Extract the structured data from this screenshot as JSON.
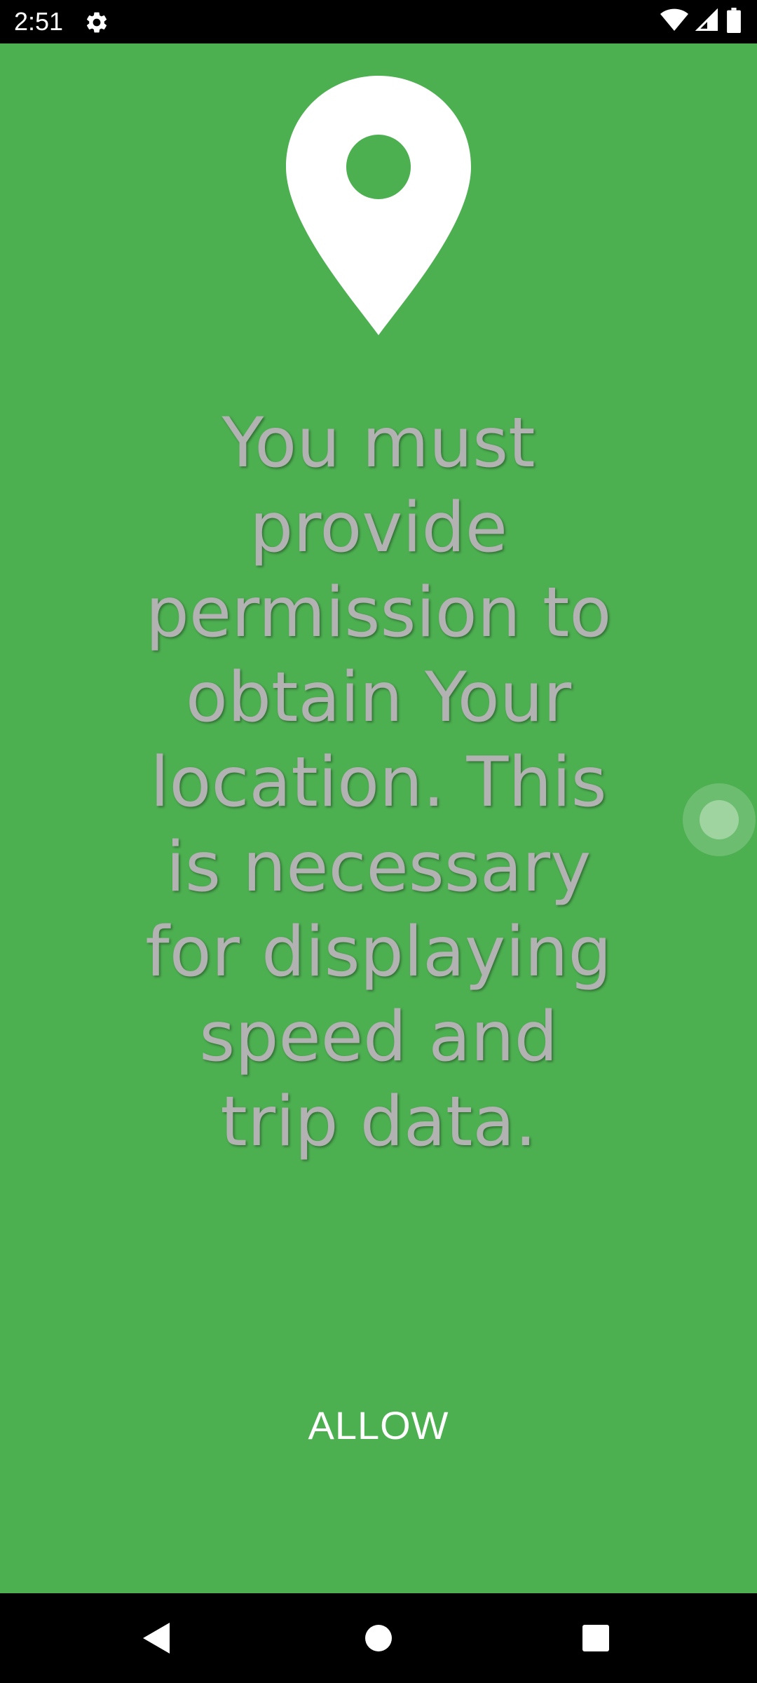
{
  "status_bar": {
    "time": "2:51",
    "icons": [
      "settings-gear-icon",
      "wifi-icon",
      "cellular-signal-icon",
      "battery-icon"
    ]
  },
  "main": {
    "background_color": "#4caf50",
    "pin_icon": "location-pin-icon",
    "message": "You must provide permission to obtain Your location. This is necessary for displaying speed and trip data.",
    "allow_label": "ALLOW"
  },
  "nav_bar": {
    "buttons": [
      "back-icon",
      "home-icon",
      "recents-icon"
    ]
  }
}
